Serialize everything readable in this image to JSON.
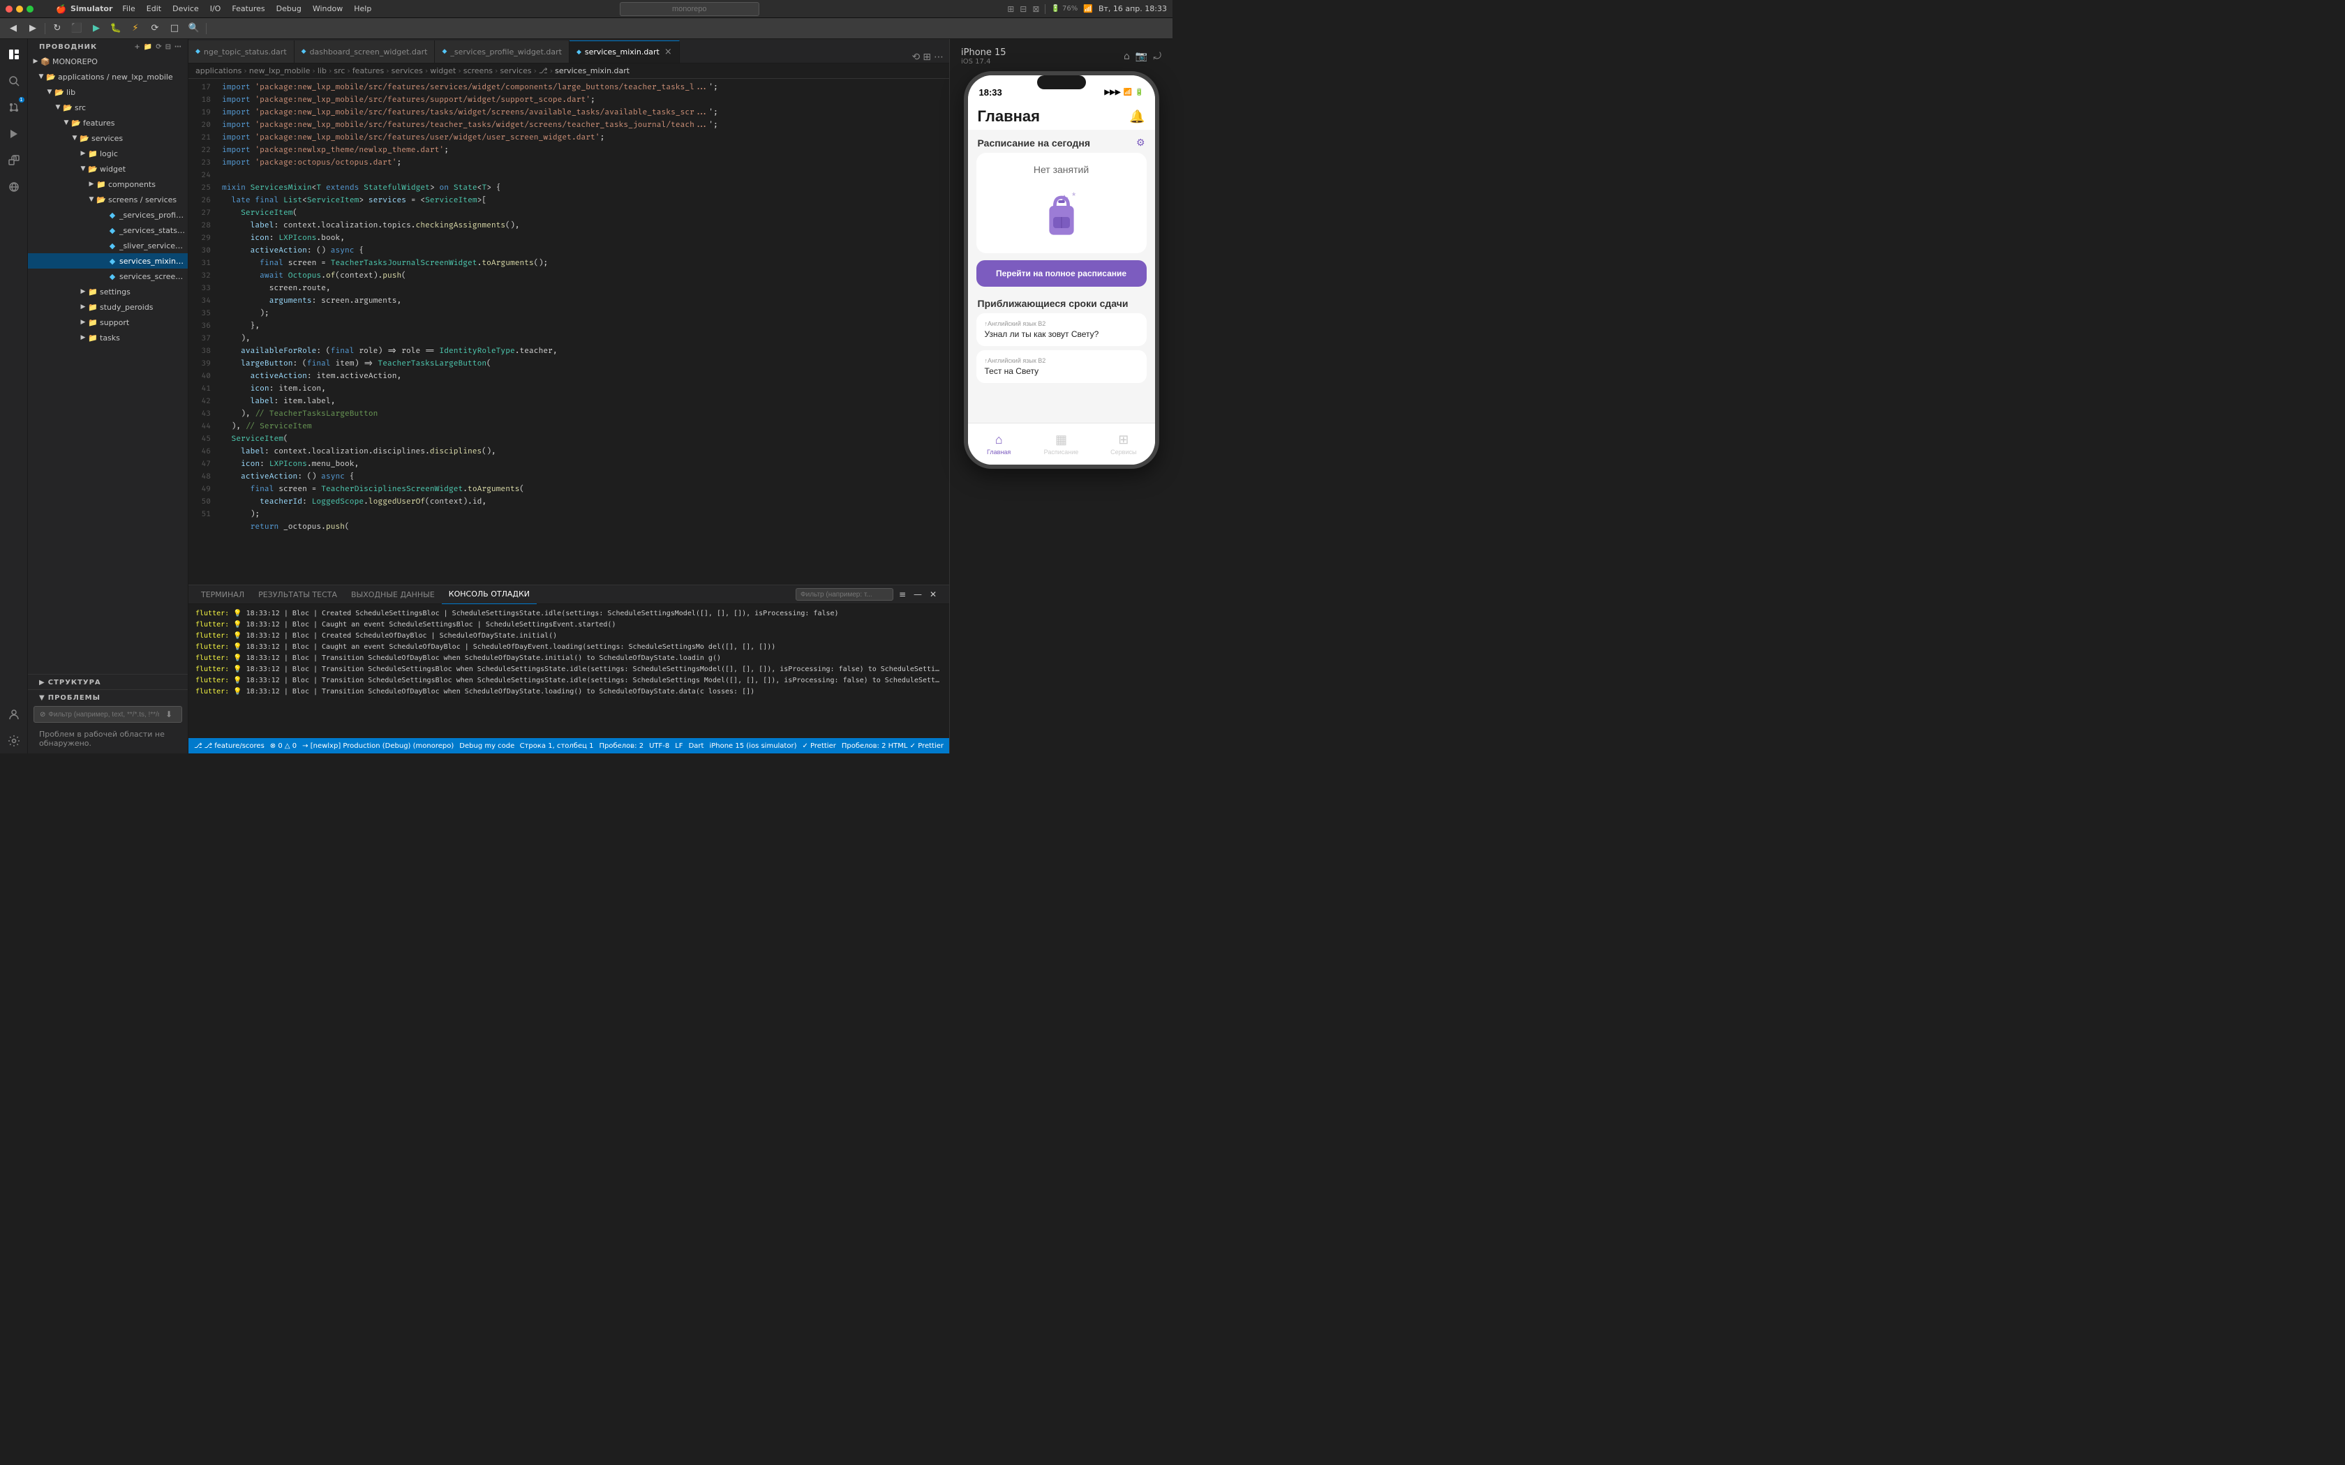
{
  "titleBar": {
    "appName": "Simulator",
    "menus": [
      "File",
      "Edit",
      "Device",
      "I/O",
      "Features",
      "Debug",
      "Window",
      "Help"
    ],
    "time": "Вт, 16 апр. 18:33",
    "searchPlaceholder": "monorepo"
  },
  "activityBar": {
    "icons": [
      {
        "name": "explorer-icon",
        "symbol": "⎇",
        "label": "Explorer",
        "active": true
      },
      {
        "name": "search-icon",
        "symbol": "🔍",
        "label": "Search"
      },
      {
        "name": "source-control-icon",
        "symbol": "⎇",
        "label": "Source Control"
      },
      {
        "name": "run-icon",
        "symbol": "▶",
        "label": "Run"
      },
      {
        "name": "extensions-icon",
        "symbol": "⬛",
        "label": "Extensions"
      },
      {
        "name": "remote-icon",
        "symbol": "⟳",
        "label": "Remote"
      }
    ],
    "bottomIcons": [
      {
        "name": "accounts-icon",
        "symbol": "👤",
        "label": "Accounts"
      },
      {
        "name": "settings-icon",
        "symbol": "⚙",
        "label": "Settings"
      }
    ]
  },
  "sidebar": {
    "title": "ПРОВОДНИК",
    "root": "MONOREPO",
    "tree": [
      {
        "id": "applications",
        "label": "applications / new_lxp_mobile",
        "level": 1,
        "type": "folder",
        "open": true
      },
      {
        "id": "lib",
        "label": "lib",
        "level": 2,
        "type": "folder",
        "open": true
      },
      {
        "id": "src",
        "label": "src",
        "level": 3,
        "type": "folder",
        "open": true
      },
      {
        "id": "features",
        "label": "features",
        "level": 4,
        "type": "folder",
        "open": true
      },
      {
        "id": "services",
        "label": "services",
        "level": 5,
        "type": "folder",
        "open": true
      },
      {
        "id": "logic",
        "label": "logic",
        "level": 6,
        "type": "folder",
        "open": false
      },
      {
        "id": "widget",
        "label": "widget",
        "level": 6,
        "type": "folder",
        "open": true
      },
      {
        "id": "components",
        "label": "components",
        "level": 7,
        "type": "folder",
        "open": false
      },
      {
        "id": "screens_services",
        "label": "screens / services",
        "level": 7,
        "type": "folder",
        "open": true,
        "selected": false
      },
      {
        "id": "_services_profile_widget",
        "label": "_services_profile_widget.dart",
        "level": 8,
        "type": "dart"
      },
      {
        "id": "_services_stats_widget",
        "label": "_services_stats_widget.dart",
        "level": 8,
        "type": "dart"
      },
      {
        "id": "_sliver_services_grid",
        "label": "_sliver_services_grid.dart",
        "level": 8,
        "type": "dart"
      },
      {
        "id": "services_mixin",
        "label": "services_mixin.dart",
        "level": 8,
        "type": "dart",
        "selected": true
      },
      {
        "id": "services_screen_widget",
        "label": "services_screen_widget.dart",
        "level": 8,
        "type": "dart"
      },
      {
        "id": "settings",
        "label": "settings",
        "level": 5,
        "type": "folder"
      },
      {
        "id": "study_peroids",
        "label": "study_peroids",
        "level": 5,
        "type": "folder"
      },
      {
        "id": "support",
        "label": "support",
        "level": 5,
        "type": "folder"
      },
      {
        "id": "tasks",
        "label": "tasks",
        "level": 5,
        "type": "folder"
      }
    ],
    "structureSection": "СТРУКТУРА",
    "problemsSection": "ПРОБЛЕМЫ",
    "filterPlaceholder": "Фильтр (например, text, **/*.ts, !**/node_mo...)",
    "problemsMessage": "Проблем в рабочей области не обнаружено."
  },
  "tabs": [
    {
      "id": "tab1",
      "label": "nge_topic_status.dart",
      "icon": "◆",
      "active": false
    },
    {
      "id": "tab2",
      "label": "dashboard_screen_widget.dart",
      "icon": "◆",
      "active": false
    },
    {
      "id": "tab3",
      "label": "_services_profile_widget.dart",
      "icon": "◆",
      "active": false
    },
    {
      "id": "tab4",
      "label": "services_mixin.dart",
      "icon": "◆",
      "active": true,
      "closable": true
    }
  ],
  "breadcrumb": [
    "applications",
    "new_lxp_mobile",
    "lib",
    "src",
    "features",
    "services",
    "widget",
    "screens",
    "services",
    "🔀",
    "services_mixin.dart"
  ],
  "code": {
    "startLine": 17,
    "lines": [
      "import 'package:new_lxp_mobile/src/features/services/widget/components/large_buttons/teacher_tasks_l...",
      "import 'package:new_lxp_mobile/src/features/support/widget/support_scope.dart';",
      "import 'package:new_lxp_mobile/src/features/tasks/widget/screens/available_tasks/available_tasks_scr...",
      "import 'package:new_lxp_mobile/src/features/teacher_tasks/widget/screens/teacher_tasks_journal/teach...",
      "import 'package:new_lxp_mobile/src/features/user/widget/user_screen_widget.dart';",
      "import 'package:newlxp_theme/newlxp_theme.dart';",
      "import 'package:octopus/octopus.dart';",
      "",
      "mixin ServicesMixin<T extends StatefulWidget> on State<T> {",
      "  late final List<ServiceItem> services = <ServiceItem>[",
      "    ServiceItem(",
      "      label: context.localization.topics.checkingAssignments(),",
      "      icon: LXPIcons.book,",
      "      activeAction: () async {",
      "        final screen = TeacherTasksJournalScreenWidget.toArguments();",
      "        await Octopus.of(context).push(",
      "          screen.route,",
      "          arguments: screen.arguments,",
      "        );",
      "      },",
      "    ),",
      "    availableForRole: (final role) => role == IdentityRoleType.teacher,",
      "    largeButton: (final item) => TeacherTasksLargeButton(",
      "      activeAction: item.activeAction,",
      "      icon: item.icon,",
      "      label: item.label,",
      "    ), // TeacherTasksLargeButton",
      "  ), // ServiceItem",
      "  ServiceItem(",
      "    label: context.localization.disciplines.disciplines(),",
      "    icon: LXPIcons.menu_book,",
      "    activeAction: () async {",
      "      final screen = TeacherDisciplinesScreenWidget.toArguments(",
      "        teacherId: LoggedScope.loggedUserOf(context).id,",
      "      );",
      "      return _octopus.push("
    ]
  },
  "terminal": {
    "tabs": [
      "ТЕРМИНАЛ",
      "РЕЗУЛЬТАТЫ ТЕСТА",
      "ВЫХОДНЫЕ ДАННЫЕ",
      "КОНСОЛЬ ОТЛАДКИ"
    ],
    "activeTab": "КОНСОЛЬ ОТЛАДКИ",
    "filterPlaceholder": "Фильтр (например: т...",
    "logs": [
      "flutter: 💡 18:33:12 | Bloc | Created ScheduleSettingsBloc | ScheduleSettingsState.idle(settings: ScheduleSettingsModel([], [], []), isProcessing: false)",
      "flutter: 💡 18:33:12 | Bloc | Caught an event ScheduleSettingsBloc | ScheduleSettingsEvent.started()",
      "flutter: 💡 18:33:12 | Bloc | Created ScheduleOfDayBloc | ScheduleOfDayState.initial()",
      "flutter: 💡 18:33:12 | Bloc | Caught an event ScheduleOfDayBloc | ScheduleOfDayEvent.loading(settings: ScheduleSettingsModel([], [], []))",
      "flutter: 💡 18:33:12 | Bloc | Transition ScheduleOfDayBloc when ScheduleOfDayState.initial() to ScheduleOfDayState.loading()",
      "flutter: 💡 18:33:12 | Bloc | Transition ScheduleSettingsBloc when ScheduleSettingsState.idle(settings: ScheduleSettingsModel([], [], []), isProcessing: false) to ScheduleSettingsState.idle(settings: ScheduleSettingsModel([], [], []), isProcessing: false)",
      "flutter: 💡 18:33:12 | Bloc | Transition ScheduleOfDayBloc when ScheduleOfDayState.initial() to ScheduleOfDayState.loading()",
      "flutter: 💡 18:33:12 | Bloc | Transition ScheduleOfDayBloc when ScheduleOfDayState.loading() to ScheduleOfDayState.data(c losses: [])"
    ]
  },
  "statusBar": {
    "left": [
      {
        "label": "⎇ feature/scores"
      },
      {
        "label": "⊗ 0  △ 0"
      },
      {
        "label": "→ [newlxp] Production (Debug) (monorepo)"
      },
      {
        "label": "Debug my code"
      }
    ],
    "right": [
      {
        "label": "Строка 1, столбец 1"
      },
      {
        "label": "Пробелов: 2"
      },
      {
        "label": "UTF-8"
      },
      {
        "label": "LF"
      },
      {
        "label": "Dart"
      },
      {
        "label": "iPhone 15 (ios simulator)"
      },
      {
        "label": "✓ Prettier"
      }
    ],
    "rightExtra": {
      "label": "Пробелов: 2  HTML  ✓ Prettier"
    }
  },
  "phone": {
    "deviceName": "iPhone 15",
    "iosVersion": "iOS 17.4",
    "time": "18:33",
    "pageTitle": "Главная",
    "scheduleSection": "Расписание на сегодня",
    "scheduleEmpty": "Нет занятий",
    "fullScheduleBtn": "Перейти на полное расписание",
    "deadlinesTitle": "Приближающиеся сроки сдачи",
    "deadlines": [
      {
        "subject": "↑Английский язык B2",
        "task": "Узнал ли ты как зовут Свету?"
      },
      {
        "subject": "↑Английский язык B2",
        "task": "Тест на Свету"
      }
    ],
    "bottomNav": [
      {
        "label": "Главная",
        "icon": "⌂",
        "active": true
      },
      {
        "label": "Расписание",
        "icon": "▦",
        "active": false
      },
      {
        "label": "Сервисы",
        "icon": "⊞",
        "active": false
      }
    ]
  }
}
